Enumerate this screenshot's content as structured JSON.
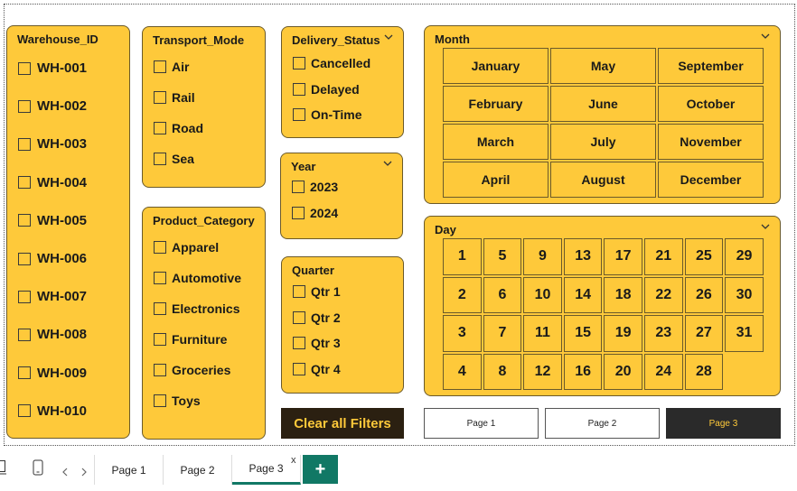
{
  "warehouse": {
    "title": "Warehouse_ID",
    "items": [
      "WH-001",
      "WH-002",
      "WH-003",
      "WH-004",
      "WH-005",
      "WH-006",
      "WH-007",
      "WH-008",
      "WH-009",
      "WH-010"
    ]
  },
  "transport": {
    "title": "Transport_Mode",
    "items": [
      "Air",
      "Rail",
      "Road",
      "Sea"
    ]
  },
  "product": {
    "title": "Product_Category",
    "items": [
      "Apparel",
      "Automotive",
      "Electronics",
      "Furniture",
      "Groceries",
      "Toys"
    ]
  },
  "delivery": {
    "title": "Delivery_Status",
    "items": [
      "Cancelled",
      "Delayed",
      "On-Time"
    ]
  },
  "year": {
    "title": "Year",
    "items": [
      "2023",
      "2024"
    ]
  },
  "quarter": {
    "title": "Quarter",
    "items": [
      "Qtr 1",
      "Qtr 2",
      "Qtr 3",
      "Qtr 4"
    ]
  },
  "month": {
    "title": "Month",
    "items": [
      "January",
      "May",
      "September",
      "February",
      "June",
      "October",
      "March",
      "July",
      "November",
      "April",
      "August",
      "December"
    ]
  },
  "day": {
    "title": "Day",
    "items": [
      "1",
      "5",
      "9",
      "13",
      "17",
      "21",
      "25",
      "29",
      "2",
      "6",
      "10",
      "14",
      "18",
      "22",
      "26",
      "30",
      "3",
      "7",
      "11",
      "15",
      "19",
      "23",
      "27",
      "31",
      "4",
      "8",
      "12",
      "16",
      "20",
      "24",
      "28"
    ]
  },
  "clear_label": "Clear all Filters",
  "nav": {
    "page1": "Page 1",
    "page2": "Page 2",
    "page3": "Page 3"
  },
  "tabs": {
    "page1": "Page 1",
    "page2": "Page 2",
    "page3": "Page 3",
    "close": "x",
    "add": "+"
  },
  "colors": {
    "slicer_bg": "#fec93a",
    "dark": "#2b2011",
    "accent_tab": "#117865",
    "nav_active": "#2a2a2a"
  }
}
